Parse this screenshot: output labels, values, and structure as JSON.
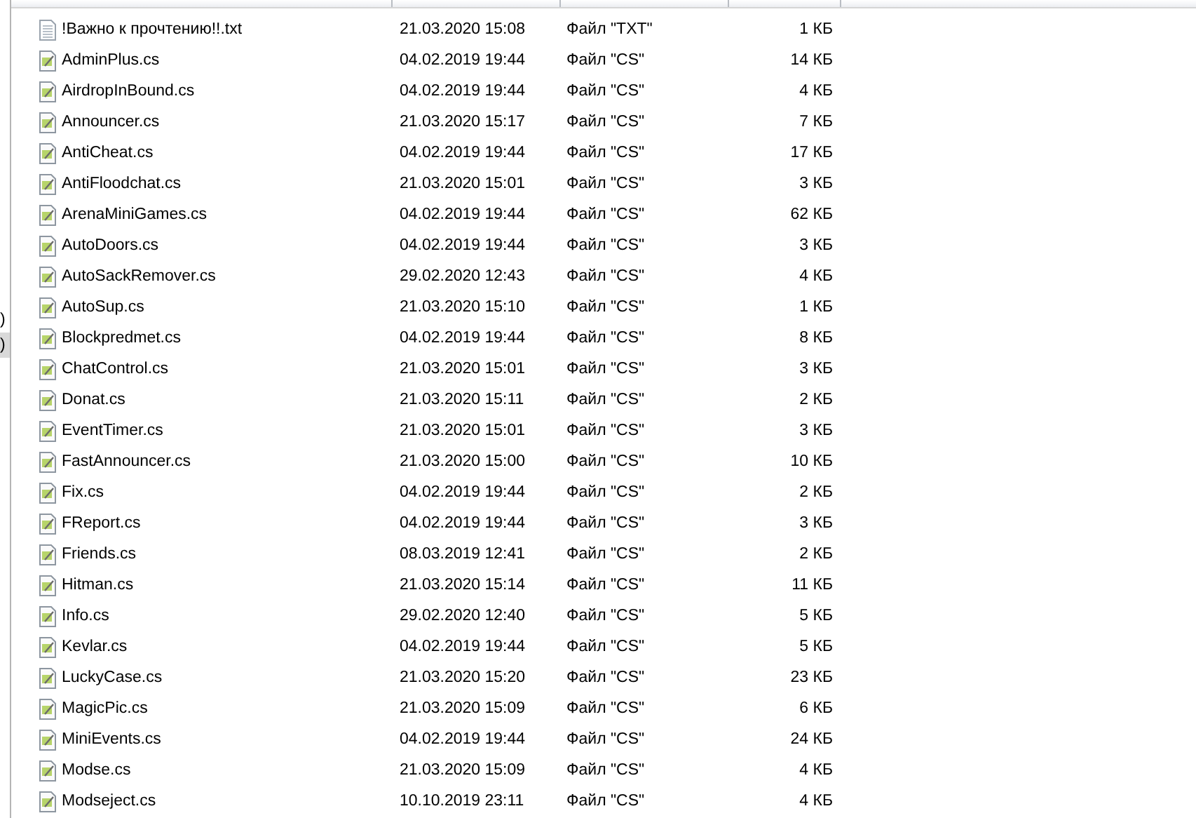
{
  "nav_pane": {
    "items": [
      {
        "label": ")",
        "selected": false
      },
      {
        "label": ")",
        "selected": true
      }
    ]
  },
  "file_list": {
    "rows": [
      {
        "name": "!Важно к прочтению!!.txt",
        "modified": "21.03.2020 15:08",
        "type": "Файл \"TXT\"",
        "size": "1 КБ",
        "kind": "text"
      },
      {
        "name": "AdminPlus.cs",
        "modified": "04.02.2019 19:44",
        "type": "Файл \"CS\"",
        "size": "14 КБ",
        "kind": "code"
      },
      {
        "name": "AirdropInBound.cs",
        "modified": "04.02.2019 19:44",
        "type": "Файл \"CS\"",
        "size": "4 КБ",
        "kind": "code"
      },
      {
        "name": "Announcer.cs",
        "modified": "21.03.2020 15:17",
        "type": "Файл \"CS\"",
        "size": "7 КБ",
        "kind": "code"
      },
      {
        "name": "AntiCheat.cs",
        "modified": "04.02.2019 19:44",
        "type": "Файл \"CS\"",
        "size": "17 КБ",
        "kind": "code"
      },
      {
        "name": "AntiFloodchat.cs",
        "modified": "21.03.2020 15:01",
        "type": "Файл \"CS\"",
        "size": "3 КБ",
        "kind": "code"
      },
      {
        "name": "ArenaMiniGames.cs",
        "modified": "04.02.2019 19:44",
        "type": "Файл \"CS\"",
        "size": "62 КБ",
        "kind": "code"
      },
      {
        "name": "AutoDoors.cs",
        "modified": "04.02.2019 19:44",
        "type": "Файл \"CS\"",
        "size": "3 КБ",
        "kind": "code"
      },
      {
        "name": "AutoSackRemover.cs",
        "modified": "29.02.2020 12:43",
        "type": "Файл \"CS\"",
        "size": "4 КБ",
        "kind": "code"
      },
      {
        "name": "AutoSup.cs",
        "modified": "21.03.2020 15:10",
        "type": "Файл \"CS\"",
        "size": "1 КБ",
        "kind": "code"
      },
      {
        "name": "Blockpredmet.cs",
        "modified": "04.02.2019 19:44",
        "type": "Файл \"CS\"",
        "size": "8 КБ",
        "kind": "code"
      },
      {
        "name": "ChatControl.cs",
        "modified": "21.03.2020 15:01",
        "type": "Файл \"CS\"",
        "size": "3 КБ",
        "kind": "code"
      },
      {
        "name": "Donat.cs",
        "modified": "21.03.2020 15:11",
        "type": "Файл \"CS\"",
        "size": "2 КБ",
        "kind": "code"
      },
      {
        "name": "EventTimer.cs",
        "modified": "21.03.2020 15:01",
        "type": "Файл \"CS\"",
        "size": "3 КБ",
        "kind": "code"
      },
      {
        "name": "FastAnnouncer.cs",
        "modified": "21.03.2020 15:00",
        "type": "Файл \"CS\"",
        "size": "10 КБ",
        "kind": "code"
      },
      {
        "name": "Fix.cs",
        "modified": "04.02.2019 19:44",
        "type": "Файл \"CS\"",
        "size": "2 КБ",
        "kind": "code"
      },
      {
        "name": "FReport.cs",
        "modified": "04.02.2019 19:44",
        "type": "Файл \"CS\"",
        "size": "3 КБ",
        "kind": "code"
      },
      {
        "name": "Friends.cs",
        "modified": "08.03.2019 12:41",
        "type": "Файл \"CS\"",
        "size": "2 КБ",
        "kind": "code"
      },
      {
        "name": "Hitman.cs",
        "modified": "21.03.2020 15:14",
        "type": "Файл \"CS\"",
        "size": "11 КБ",
        "kind": "code"
      },
      {
        "name": "Info.cs",
        "modified": "29.02.2020 12:40",
        "type": "Файл \"CS\"",
        "size": "5 КБ",
        "kind": "code"
      },
      {
        "name": "Kevlar.cs",
        "modified": "04.02.2019 19:44",
        "type": "Файл \"CS\"",
        "size": "5 КБ",
        "kind": "code"
      },
      {
        "name": "LuckyCase.cs",
        "modified": "21.03.2020 15:20",
        "type": "Файл \"CS\"",
        "size": "23 КБ",
        "kind": "code"
      },
      {
        "name": "MagicPic.cs",
        "modified": "21.03.2020 15:09",
        "type": "Файл \"CS\"",
        "size": "6 КБ",
        "kind": "code"
      },
      {
        "name": "MiniEvents.cs",
        "modified": "04.02.2019 19:44",
        "type": "Файл \"CS\"",
        "size": "24 КБ",
        "kind": "code"
      },
      {
        "name": "Modse.cs",
        "modified": "21.03.2020 15:09",
        "type": "Файл \"CS\"",
        "size": "4 КБ",
        "kind": "code"
      },
      {
        "name": "Modseject.cs",
        "modified": "10.10.2019 23:11",
        "type": "Файл \"CS\"",
        "size": "4 КБ",
        "kind": "code"
      }
    ]
  }
}
